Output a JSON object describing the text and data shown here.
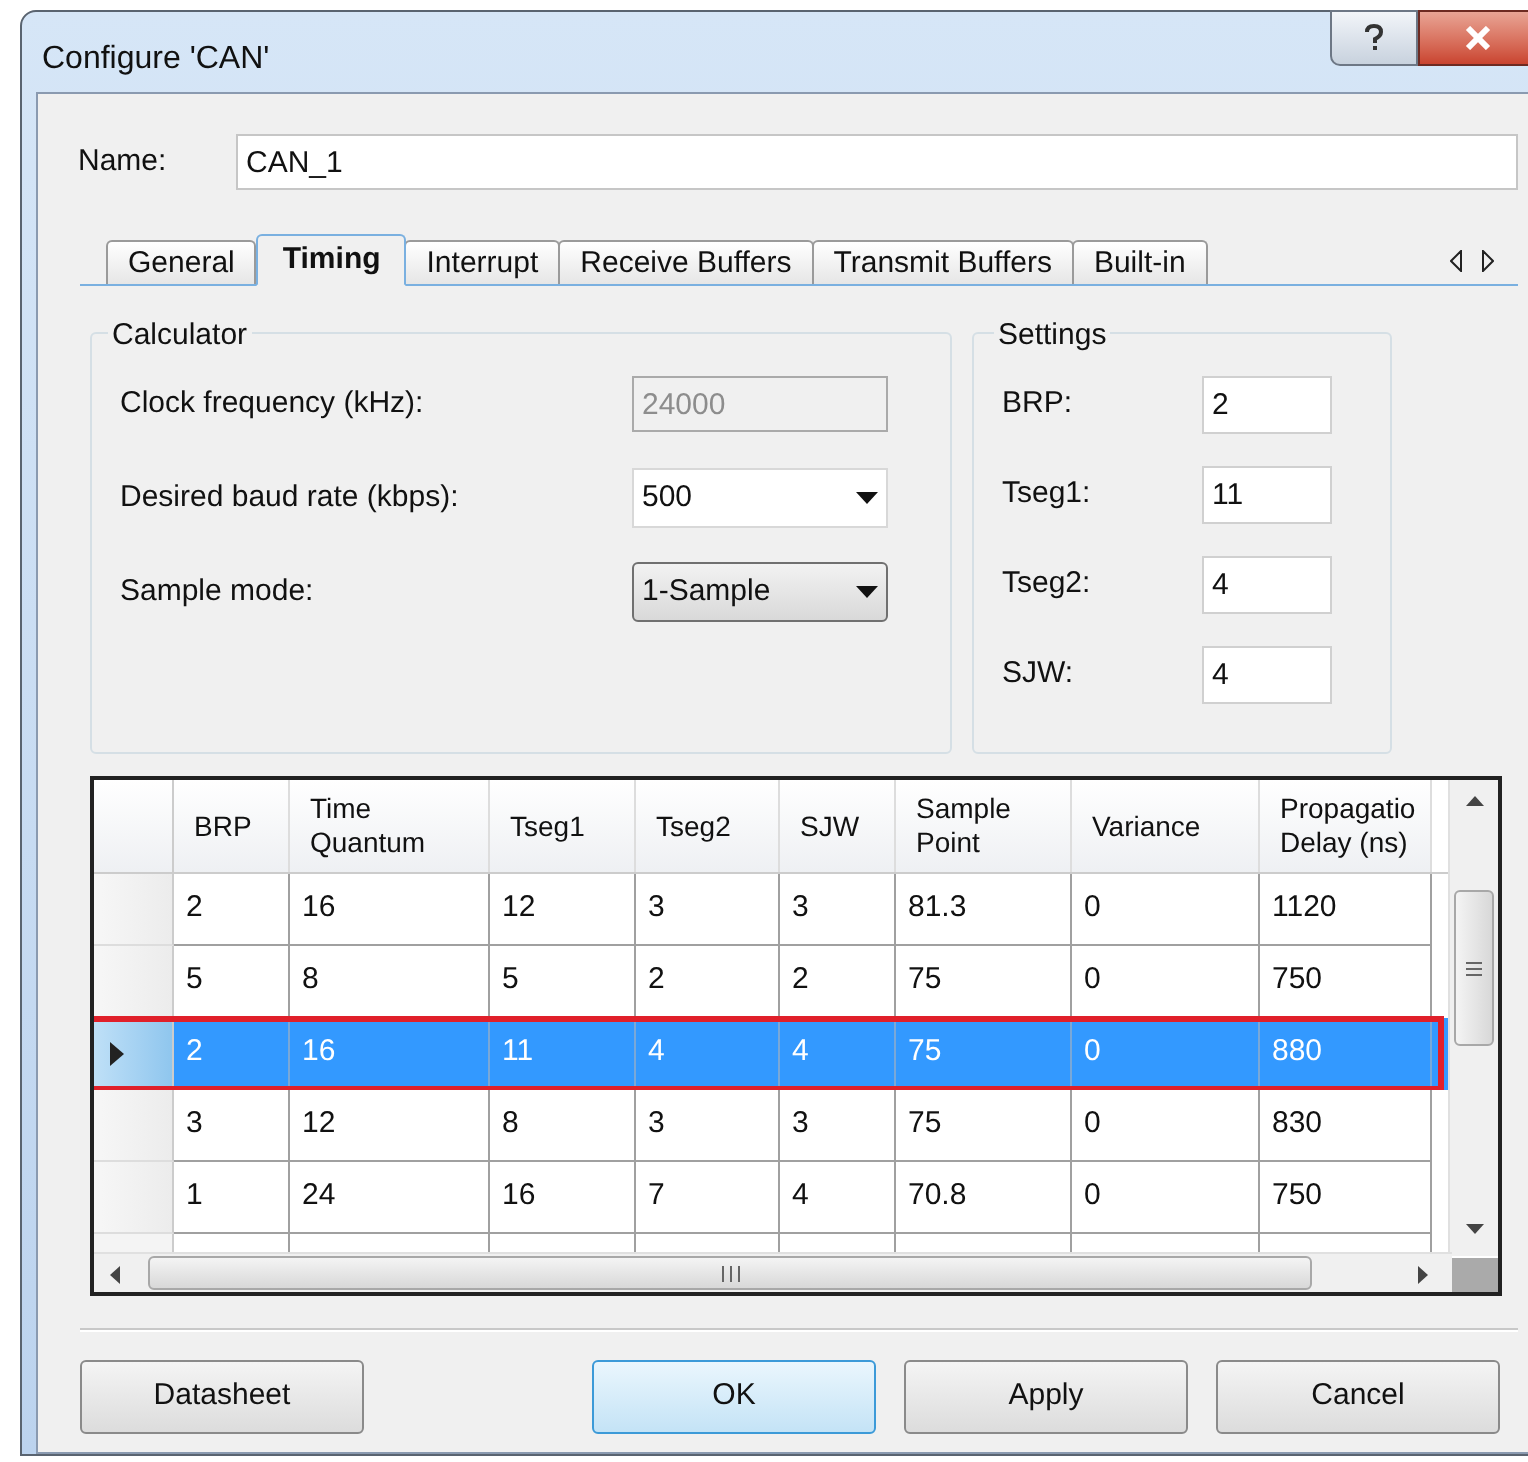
{
  "window": {
    "title": "Configure 'CAN'"
  },
  "name_field": {
    "label": "Name:",
    "value": "CAN_1"
  },
  "tabs": [
    {
      "label": "General",
      "selected": false
    },
    {
      "label": "Timing",
      "selected": true
    },
    {
      "label": "Interrupt",
      "selected": false
    },
    {
      "label": "Receive Buffers",
      "selected": false
    },
    {
      "label": "Transmit Buffers",
      "selected": false
    },
    {
      "label": "Built-in",
      "selected": false
    }
  ],
  "calculator": {
    "title": "Calculator",
    "fields": [
      {
        "label": "Clock frequency (kHz):",
        "value": "24000",
        "kind": "text",
        "disabled": true
      },
      {
        "label": "Desired baud rate (kbps):",
        "value": "500",
        "kind": "combo",
        "disabled": false
      },
      {
        "label": "Sample mode:",
        "value": "1-Sample",
        "kind": "dropdown",
        "disabled": false
      }
    ]
  },
  "settings": {
    "title": "Settings",
    "fields": [
      {
        "label": "BRP:",
        "value": "2"
      },
      {
        "label": "Tseg1:",
        "value": "11"
      },
      {
        "label": "Tseg2:",
        "value": "4"
      },
      {
        "label": "SJW:",
        "value": "4"
      }
    ]
  },
  "table": {
    "columns": [
      "BRP",
      "Time Quantum",
      "Tseg1",
      "Tseg2",
      "SJW",
      "Sample Point",
      "Variance",
      "Propagatio Delay (ns)"
    ],
    "rows": [
      {
        "cells": [
          "2",
          "16",
          "12",
          "3",
          "3",
          "81.3",
          "0",
          "1120"
        ],
        "selected": false,
        "outlined": false
      },
      {
        "cells": [
          "5",
          "8",
          "5",
          "2",
          "2",
          "75",
          "0",
          "750"
        ],
        "selected": false,
        "outlined": false
      },
      {
        "cells": [
          "2",
          "16",
          "11",
          "4",
          "4",
          "75",
          "0",
          "880"
        ],
        "selected": true,
        "outlined": true
      },
      {
        "cells": [
          "3",
          "12",
          "8",
          "3",
          "3",
          "75",
          "0",
          "830"
        ],
        "selected": false,
        "outlined": false
      },
      {
        "cells": [
          "1",
          "24",
          "16",
          "7",
          "4",
          "70.8",
          "0",
          "750"
        ],
        "selected": false,
        "outlined": false
      }
    ]
  },
  "buttons": [
    {
      "label": "Datasheet",
      "kind": "normal"
    },
    {
      "label": "OK",
      "kind": "default"
    },
    {
      "label": "Apply",
      "kind": "normal"
    },
    {
      "label": "Cancel",
      "kind": "normal"
    }
  ]
}
